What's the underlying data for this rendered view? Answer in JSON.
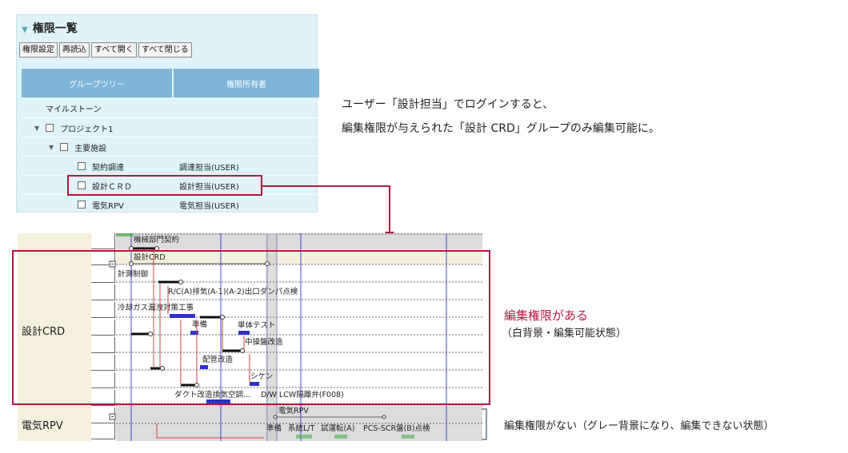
{
  "panel": {
    "title": "権限一覧",
    "buttons": [
      "権限設定",
      "再読込",
      "すべて開く",
      "すべて閉じる"
    ],
    "headers": [
      "グループツリー",
      "権限所有者"
    ],
    "rows": [
      {
        "name": "マイルストーン",
        "owner": ""
      },
      {
        "name": "プロジェクト1",
        "owner": ""
      },
      {
        "name": "主要施設",
        "owner": ""
      },
      {
        "name": "契約調達",
        "owner": "調達担当(USER)"
      },
      {
        "name": "設計ＣＲＤ",
        "owner": "設計担当(USER)"
      },
      {
        "name": "電気RPV",
        "owner": "電気担当(USER)"
      }
    ]
  },
  "description": {
    "line1": "ユーザー「設計担当」でログインすると、",
    "line2": "編集権限が与えられた「設計 CRD」グループのみ編集可能に。"
  },
  "gantt": {
    "group_crd": "設計CRD",
    "group_rpv": "電気RPV",
    "tasks": [
      "機械部門契約",
      "設計CRD",
      "計測制御",
      "R/C(A)排気(A-1)(A-2)出口ダンパ点検",
      "冷却ガス漏洩対策工事",
      "準備",
      "単体テスト",
      "中操盤改造",
      "配管改造",
      "シケン",
      "ダクト改造",
      "換気空調...",
      "D/W LCW隔離弁(F008)",
      "電気RPV",
      "準備",
      "系統L/T",
      "試運転(A)",
      "PCS-SCR盤(B)点検"
    ]
  },
  "notes": {
    "editable_title": "編集権限がある",
    "editable_sub": "（白背景・編集可能状態）",
    "noneditable": "編集権限がない（グレー背景になり、編集できない状態）"
  },
  "colors": {
    "accent": "#b5163f",
    "panel_bg": "#dff3f8",
    "header_bg": "#7db6d8",
    "readonly_bg": "#dcdcdc",
    "bar_blue": "#3030c8"
  }
}
